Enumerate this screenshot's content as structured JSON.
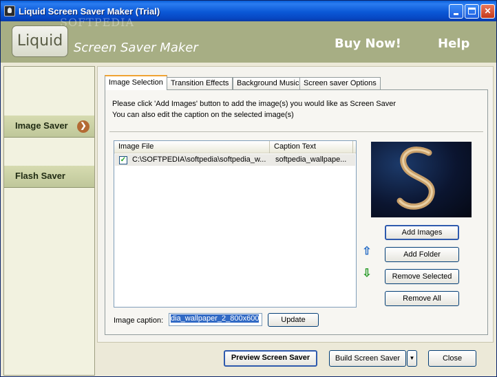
{
  "window": {
    "title": "Liquid Screen Saver Maker (Trial)"
  },
  "header": {
    "logo_text": "Liquid",
    "subtitle": "Screen Saver Maker",
    "watermark": "SOFTPEDIA",
    "buy_now": "Buy Now!",
    "help": "Help"
  },
  "sidebar": {
    "items": [
      {
        "label": "Image Saver",
        "active": true
      },
      {
        "label": "Flash Saver",
        "active": false
      }
    ]
  },
  "tabs": [
    {
      "label": "Image Selection",
      "active": true
    },
    {
      "label": "Transition Effects",
      "active": false
    },
    {
      "label": "Background Music",
      "active": false
    },
    {
      "label": "Screen saver Options",
      "active": false
    }
  ],
  "image_selection": {
    "instruction_line1": "Please click 'Add Images' button to add the image(s) you would like as Screen Saver",
    "instruction_line2": "You can also edit the caption on the selected image(s)",
    "columns": [
      "Image File",
      "Caption Text"
    ],
    "rows": [
      {
        "checked": true,
        "file": "C:\\SOFTPEDIA\\softpedia\\softpedia_w...",
        "caption": "softpedia_wallpape..."
      }
    ],
    "buttons": {
      "add_images": "Add Images",
      "add_folder": "Add Folder",
      "remove_selected": "Remove Selected",
      "remove_all": "Remove All"
    },
    "icons": {
      "move_up": "arrow-up-icon",
      "move_down": "arrow-down-icon"
    },
    "caption_label": "Image caption:",
    "caption_value": "dia_wallpaper_2_800x600",
    "update_label": "Update"
  },
  "footer": {
    "preview": "Preview Screen Saver",
    "build": "Build Screen Saver",
    "close": "Close"
  },
  "colors": {
    "titlebar": "#0b58d6",
    "banner": "#a7ae84",
    "sidebar_item": "#c9d0a4",
    "tab_highlight": "#f0a332",
    "selection": "#316ac5"
  }
}
